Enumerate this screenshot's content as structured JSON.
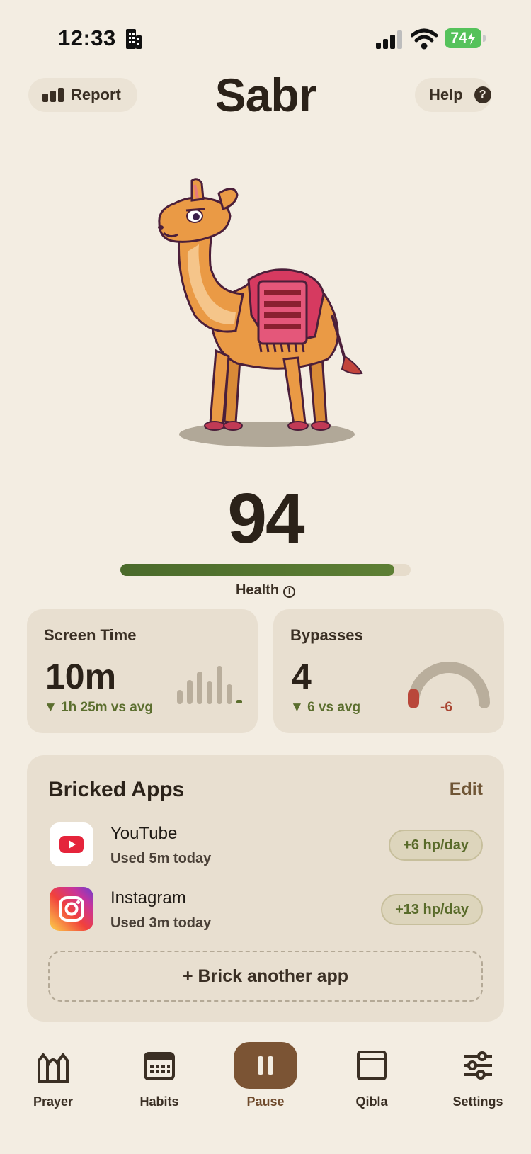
{
  "status_bar": {
    "time": "12:33",
    "battery": "74"
  },
  "header": {
    "report_label": "Report",
    "title": "Sabr",
    "help_label": "Help",
    "help_icon_text": "?"
  },
  "health": {
    "value": "94",
    "label": "Health",
    "fraction": 0.945,
    "info_icon_text": "i"
  },
  "stats": {
    "screen_time": {
      "title": "Screen Time",
      "value": "10m",
      "delta": "▼ 1h 25m vs avg"
    },
    "bypasses": {
      "title": "Bypasses",
      "value": "4",
      "delta": "▼ 6 vs avg",
      "gauge_value": "-6"
    }
  },
  "bricked": {
    "title": "Bricked Apps",
    "edit_label": "Edit",
    "apps": [
      {
        "name": "YouTube",
        "usage": "Used 5m today",
        "badge": "+6 hp/day"
      },
      {
        "name": "Instagram",
        "usage": "Used 3m today",
        "badge": "+13 hp/day"
      }
    ],
    "add_label": "+ Brick another app"
  },
  "tabs": [
    {
      "label": "Prayer",
      "icon": "mosque-arch-icon"
    },
    {
      "label": "Habits",
      "icon": "calendar-icon"
    },
    {
      "label": "Pause",
      "icon": "pause-icon"
    },
    {
      "label": "Qibla",
      "icon": "window-icon"
    },
    {
      "label": "Settings",
      "icon": "sliders-icon"
    }
  ],
  "colors": {
    "background": "#f3ede2",
    "accent": "#7b5434",
    "health_fill": "#5d7f34",
    "positive": "#5b6e2e",
    "negative": "#a8432f"
  }
}
